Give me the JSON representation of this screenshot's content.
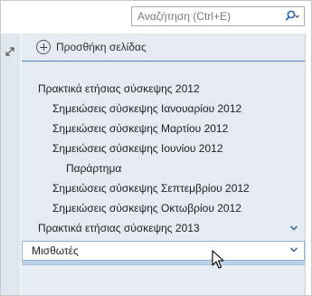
{
  "search": {
    "placeholder": "Αναζήτηση (Ctrl+E)",
    "icon": "magnifier-icon"
  },
  "add_page": {
    "label": "Προσθήκη σελίδας",
    "icon": "plus-circle-icon"
  },
  "pages": [
    {
      "title": "Πρακτικά ετήσιας σύσκεψης 2012",
      "level": 0
    },
    {
      "title": "Σημειώσεις σύσκεψης Ιανουαρίου 2012",
      "level": 1
    },
    {
      "title": "Σημειώσεις σύσκεψης Μαρτίου 2012",
      "level": 1
    },
    {
      "title": "Σημειώσεις σύσκεψης Ιουνίου 2012",
      "level": 1
    },
    {
      "title": "Παράρτημα",
      "level": 2
    },
    {
      "title": "Σημειώσεις σύσκεψης Σεπτεμβρίου 2012",
      "level": 1
    },
    {
      "title": "Σημειώσεις σύσκεψης Οκτωβρίου 2012",
      "level": 1
    },
    {
      "title": "Πρακτικά ετήσιας σύσκεψης 2013",
      "level": 0,
      "collapsed": true
    }
  ],
  "section": {
    "label": "Μισθωτές"
  },
  "colors": {
    "panel_bg": "#e4ebf2",
    "accent": "#4e7fb6",
    "chevron": "#4a6f99"
  }
}
